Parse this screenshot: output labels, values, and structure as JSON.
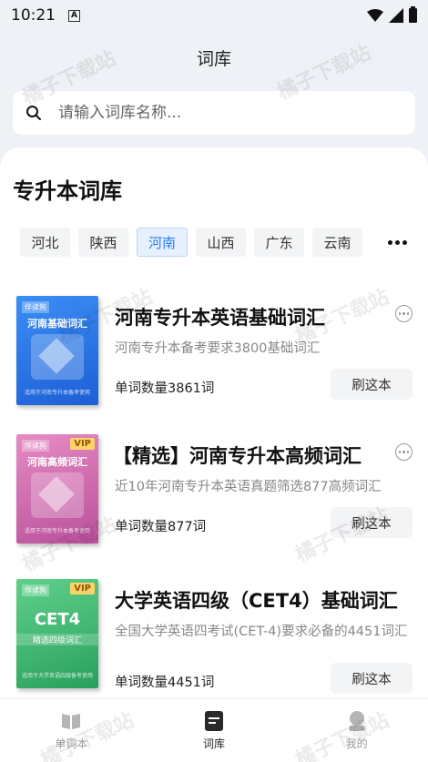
{
  "status_bar": {
    "time": "10:21",
    "a_icon_text": "A"
  },
  "header": {
    "title": "词库"
  },
  "search": {
    "placeholder": "请输入词库名称..."
  },
  "section": {
    "title": "专升本词库"
  },
  "regions": [
    {
      "label": "河北",
      "active": false
    },
    {
      "label": "陕西",
      "active": false
    },
    {
      "label": "河南",
      "active": true
    },
    {
      "label": "山西",
      "active": false
    },
    {
      "label": "广东",
      "active": false
    },
    {
      "label": "云南",
      "active": false
    }
  ],
  "books": [
    {
      "title": "河南专升本英语基础词汇",
      "description": "河南专升本备考要求3800基础词汇",
      "count": "单词数量3861词",
      "action": "刷这本",
      "cover": {
        "brand": "伴读狗",
        "title": "河南基础词汇",
        "footer": "适用于河南专升本备考使用",
        "theme": "blue",
        "vip": ""
      }
    },
    {
      "title": "【精选】河南专升本高频词汇",
      "description": "近10年河南专升本英语真题筛选877高频词汇",
      "count": "单词数量877词",
      "action": "刷这本",
      "cover": {
        "brand": "伴读狗",
        "title": "河南高频词汇",
        "footer": "适用于河南专升本备考使用",
        "theme": "pink",
        "vip": "VIP"
      }
    },
    {
      "title": "大学英语四级（CET4）基础词汇",
      "description": "全国大学英语四考试(CET-4)要求必备的4451词汇",
      "count": "单词数量4451词",
      "action": "刷这本",
      "cover": {
        "brand": "伴读狗",
        "title": "CET4",
        "subtitle": "精选四级词汇",
        "footer": "适用于大学英语四级备考使用",
        "theme": "green",
        "vip": "VIP"
      }
    }
  ],
  "tabbar": [
    {
      "label": "单词本",
      "active": false,
      "icon": "book-icon"
    },
    {
      "label": "词库",
      "active": true,
      "icon": "list-icon"
    },
    {
      "label": "我的",
      "active": false,
      "icon": "user-icon"
    }
  ],
  "watermark": "橘子下载站",
  "colors": {
    "accent": "#2b7bf0",
    "active_region_bg": "#e6f0ff"
  }
}
